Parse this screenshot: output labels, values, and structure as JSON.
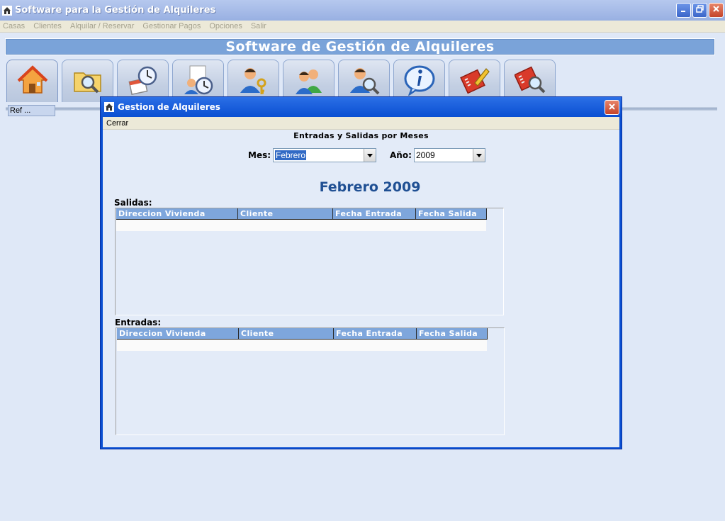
{
  "app": {
    "title": "Software para la Gestión de Alquileres",
    "icon": "house-icon"
  },
  "menu": [
    "Casas",
    "Clientes",
    "Alquilar / Reservar",
    "Gestionar Pagos",
    "Opciones",
    "Salir"
  ],
  "banner": {
    "title": "Software de Gestión de Alquileres"
  },
  "toolbar": {
    "buttons": [
      {
        "icon": "house-icon"
      },
      {
        "icon": "folder-search-icon"
      },
      {
        "icon": "calendar-clock-icon"
      },
      {
        "icon": "person-clock-icon"
      },
      {
        "icon": "person-keys-icon"
      },
      {
        "icon": "people-icon"
      },
      {
        "icon": "person-search-icon"
      },
      {
        "icon": "info-icon"
      },
      {
        "icon": "notebook-edit-icon"
      },
      {
        "icon": "notebook-search-icon"
      }
    ]
  },
  "ref": {
    "label": "Ref ..."
  },
  "dialog": {
    "title": "Gestion de Alquileres",
    "menu": {
      "close": "Cerrar"
    },
    "subtitle": "Entradas y Salidas por Meses",
    "month": {
      "label": "Mes:",
      "value": "Febrero"
    },
    "year": {
      "label": "Año:",
      "value": "2009"
    },
    "period": "Febrero 2009",
    "exits": {
      "label": "Salidas:",
      "columns": [
        "Direccion Vivienda",
        "Cliente",
        "Fecha Entrada",
        "Fecha Salida"
      ],
      "rows": []
    },
    "entries": {
      "label": "Entradas:",
      "columns": [
        "Direccion Vivienda",
        "Cliente",
        "Fecha Entrada",
        "Fecha Salida"
      ],
      "rows": []
    }
  },
  "colors": {
    "titlebar": "#98b0e2",
    "banner": "#7aa3d9",
    "dialog_frame": "#0a4fd2",
    "grid_header": "#7ea6dc",
    "period_text": "#1f4f93",
    "background": "#dfe8f7"
  }
}
